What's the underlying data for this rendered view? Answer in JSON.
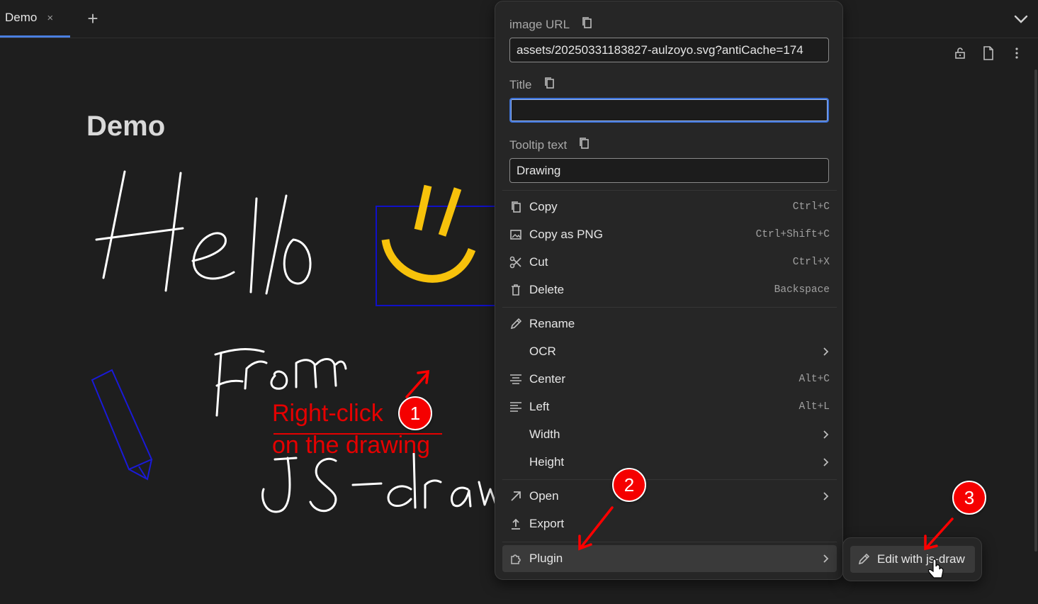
{
  "tabs": [
    {
      "label": "Demo",
      "close": "×"
    }
  ],
  "new_tab": "+",
  "document": {
    "title": "Demo"
  },
  "annotation": {
    "line1": "Right-click",
    "line2": "on the drawing"
  },
  "badges": [
    "1",
    "2",
    "3"
  ],
  "context_menu": {
    "fields": [
      {
        "label": "image URL",
        "value": "assets/20250331183827-aulzoyo.svg?antiCache=174"
      },
      {
        "label": "Title",
        "value": ""
      },
      {
        "label": "Tooltip text",
        "value": "Drawing"
      }
    ],
    "items": [
      {
        "label": "Copy",
        "shortcut": "Ctrl+C",
        "icon": "copy-icon"
      },
      {
        "label": "Copy as PNG",
        "shortcut": "Ctrl+Shift+C",
        "icon": "image-icon"
      },
      {
        "label": "Cut",
        "shortcut": "Ctrl+X",
        "icon": "scissors-icon"
      },
      {
        "label": "Delete",
        "shortcut": "Backspace",
        "icon": "trash-icon"
      },
      {
        "label": "Rename",
        "shortcut": "",
        "icon": "pencil-icon"
      },
      {
        "label": "OCR",
        "shortcut": "",
        "icon": ""
      },
      {
        "label": "Center",
        "shortcut": "Alt+C",
        "icon": "align-center-icon"
      },
      {
        "label": "Left",
        "shortcut": "Alt+L",
        "icon": "align-left-icon"
      },
      {
        "label": "Width",
        "shortcut": "",
        "icon": ""
      },
      {
        "label": "Height",
        "shortcut": "",
        "icon": ""
      },
      {
        "label": "Open",
        "shortcut": "",
        "icon": "open-arrow-icon"
      },
      {
        "label": "Export",
        "shortcut": "",
        "icon": "upload-icon"
      },
      {
        "label": "Plugin",
        "shortcut": "",
        "icon": "puzzle-icon"
      }
    ]
  },
  "submenu": {
    "label": "Edit with js-draw",
    "icon": "pencil-icon"
  },
  "colors": {
    "accent": "#3d72d8",
    "annotation_red": "#e50000",
    "smiley": "#f7c20b",
    "selection_blue": "#1010c8"
  }
}
